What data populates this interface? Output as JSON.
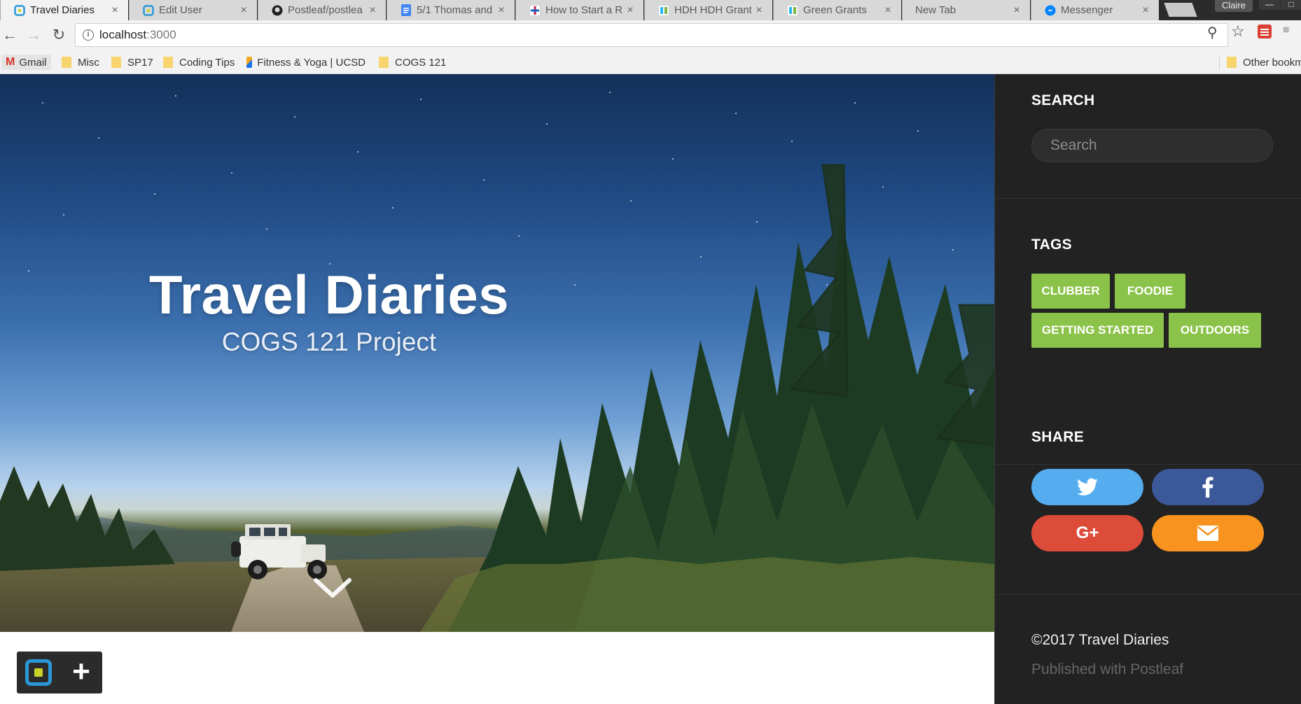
{
  "browser": {
    "tabs": [
      {
        "title": "Travel Diaries",
        "icon": "postleaf-icon",
        "active": true
      },
      {
        "title": "Edit User",
        "icon": "postleaf-icon",
        "active": false
      },
      {
        "title": "Postleaf/postlea",
        "icon": "github-icon",
        "active": false
      },
      {
        "title": "5/1 Thomas and",
        "icon": "google-docs-icon",
        "active": false
      },
      {
        "title": "How to Start a R",
        "icon": "plus-box-icon",
        "active": false
      },
      {
        "title": "HDH HDH Grant",
        "icon": "hdh-icon",
        "active": false
      },
      {
        "title": "Green Grants",
        "icon": "hdh-icon",
        "active": false
      },
      {
        "title": "New Tab",
        "icon": "",
        "active": false
      },
      {
        "title": "Messenger",
        "icon": "messenger-icon",
        "active": false
      }
    ],
    "close_glyph": "×",
    "profile_name": "Claire",
    "url_host": "localhost",
    "url_port": ":3000",
    "bookmarks": [
      {
        "label": "Gmail",
        "icon": "gmail-icon"
      },
      {
        "label": "Misc",
        "icon": "folder-icon"
      },
      {
        "label": "SP17",
        "icon": "folder-icon"
      },
      {
        "label": "Coding Tips",
        "icon": "folder-icon"
      },
      {
        "label": "Fitness & Yoga | UCSD",
        "icon": "ucsd-icon"
      },
      {
        "label": "COGS 121",
        "icon": "folder-icon"
      }
    ],
    "other_bookmarks": "Other bookm"
  },
  "hero": {
    "title": "Travel Diaries",
    "subtitle": "COGS 121 Project"
  },
  "sidebar": {
    "search": {
      "heading": "SEARCH",
      "placeholder": "Search"
    },
    "tags": {
      "heading": "TAGS",
      "items": [
        "CLUBBER",
        "FOODIE",
        "GETTING STARTED",
        "OUTDOORS"
      ],
      "color": "#8bc34a"
    },
    "share": {
      "heading": "SHARE",
      "buttons": [
        {
          "name": "twitter",
          "icon": "twitter-icon",
          "color": "#55acee"
        },
        {
          "name": "facebook",
          "icon": "facebook-icon",
          "color": "#3b5998"
        },
        {
          "name": "google-plus",
          "icon": "google-plus-icon",
          "glyph": "G+",
          "color": "#dd4b39"
        },
        {
          "name": "email",
          "icon": "envelope-icon",
          "color": "#f7931e"
        }
      ]
    },
    "footer": {
      "copyright": "©2017 Travel Diaries",
      "published": "Published with Postleaf"
    }
  },
  "colors": {
    "sidebar_bg": "#222222",
    "tag_green": "#8bc34a",
    "admin_blue": "#2a98d6",
    "admin_lime": "#c9d32a"
  }
}
